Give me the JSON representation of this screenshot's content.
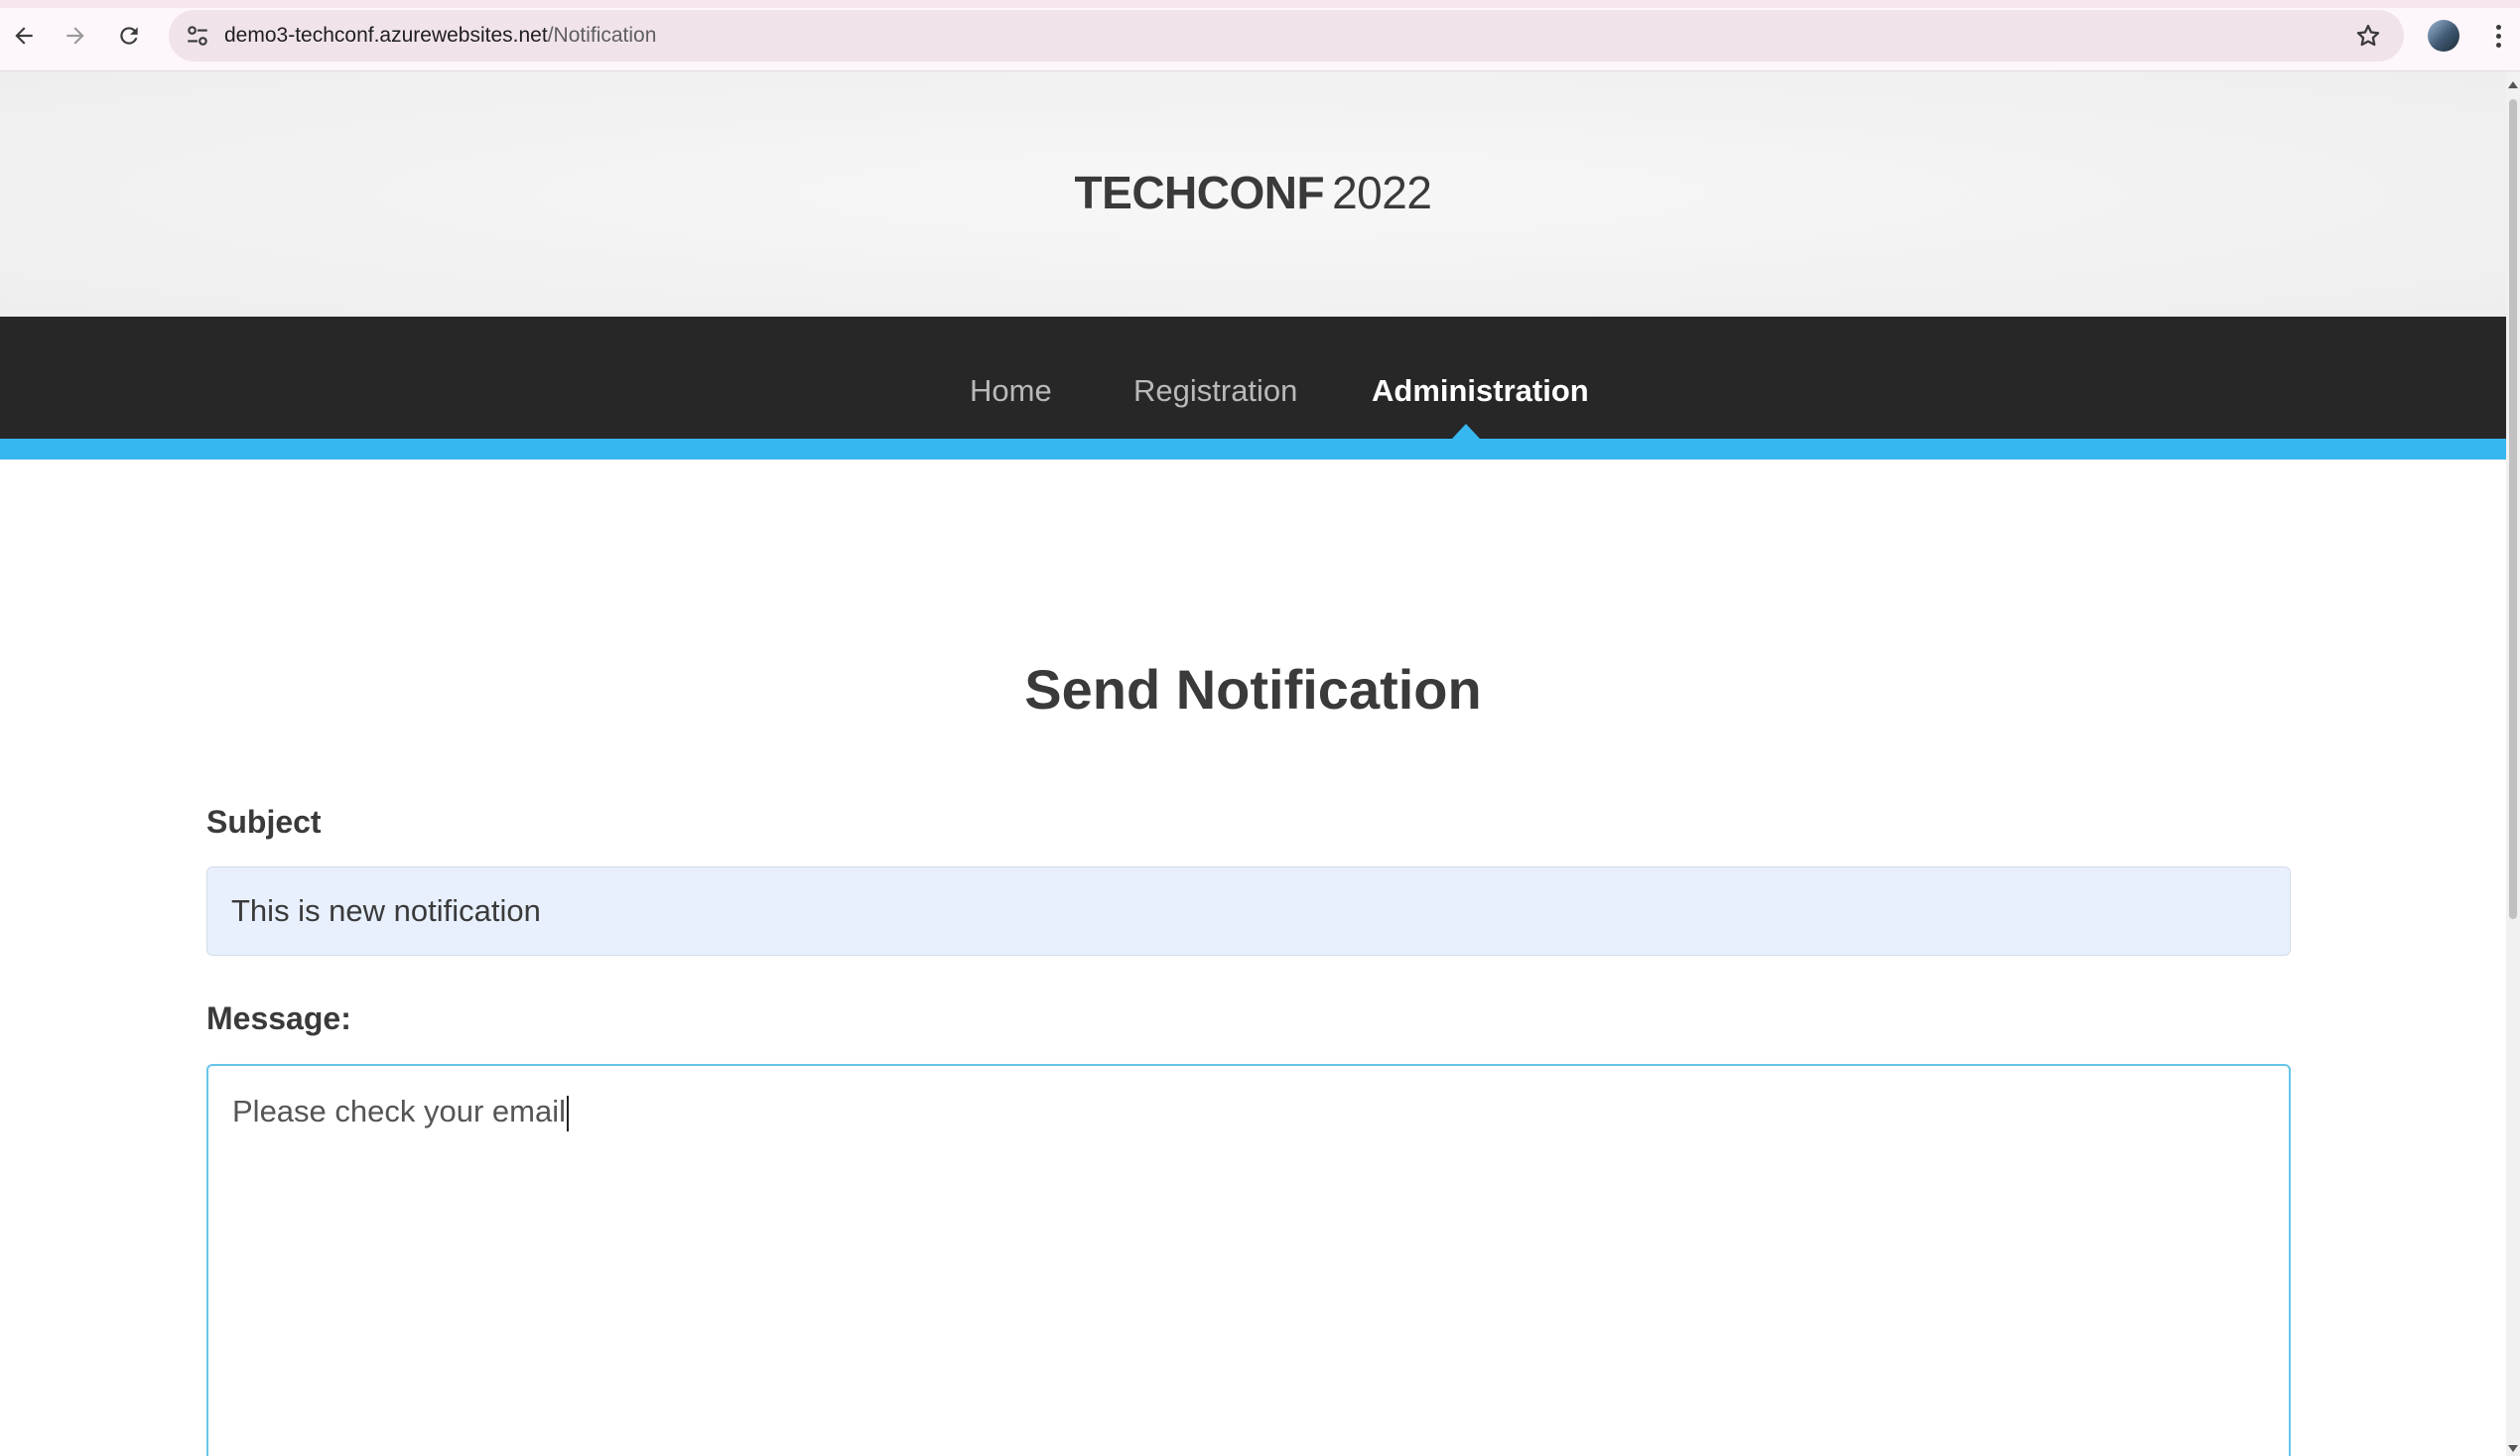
{
  "browser": {
    "url_host": "demo3-techconf.azurewebsites.net",
    "url_path": "/Notification",
    "icons": [
      "back-icon",
      "forward-icon",
      "reload-icon",
      "site-info-icon",
      "bookmark-star-icon",
      "profile-avatar",
      "more-menu-icon"
    ]
  },
  "header": {
    "brand": "TECHCONF",
    "year": "2022"
  },
  "nav": {
    "items": [
      {
        "label": "Home",
        "active": false
      },
      {
        "label": "Registration",
        "active": false
      },
      {
        "label": "Administration",
        "active": true
      }
    ],
    "accent_color": "#37b7ef"
  },
  "form": {
    "title": "Send Notification",
    "subject_label": "Subject",
    "subject_value": "This is new notification",
    "message_label": "Message:",
    "message_value": "Please check your email"
  }
}
